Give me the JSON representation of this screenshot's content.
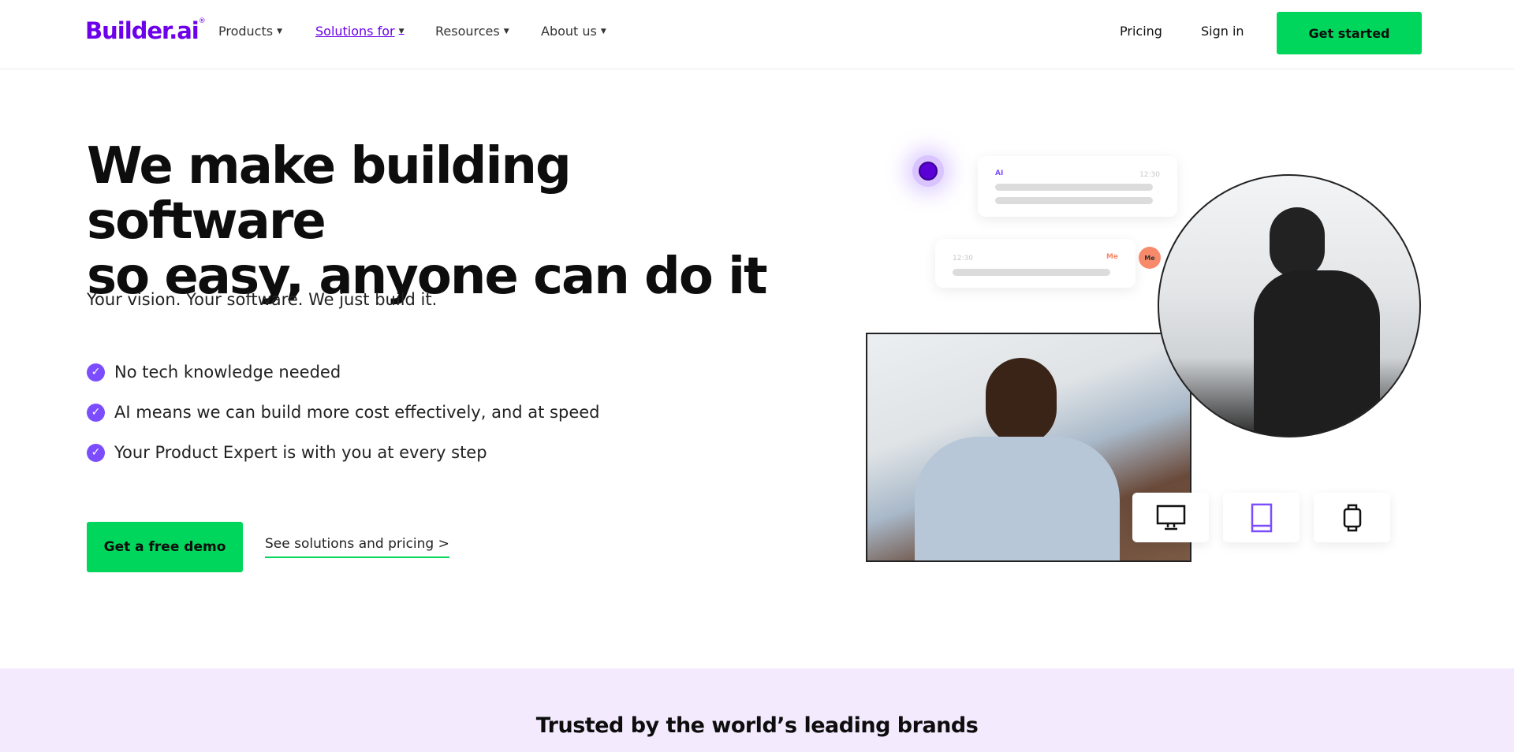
{
  "header": {
    "logo": "Builder.ai",
    "nav": [
      {
        "label": "Products"
      },
      {
        "label": "Solutions for",
        "active": true
      },
      {
        "label": "Resources"
      },
      {
        "label": "About us"
      }
    ],
    "pricing": "Pricing",
    "sign_in": "Sign in",
    "get_started": "Get started"
  },
  "hero": {
    "title_line1": "We make building software",
    "title_line2": "so easy, anyone can do it",
    "subtitle": "Your vision. Your software. We just build it.",
    "features": [
      "No tech knowledge needed",
      "AI means we can build more cost effectively, and at speed",
      "Your Product Expert is with you at every step"
    ],
    "demo_button": "Get a free demo",
    "solutions_link": "See solutions and pricing >"
  },
  "illustration": {
    "ai_label": "AI",
    "ai_time": "12:30",
    "me_label": "Me",
    "me_time": "12:30",
    "me_avatar": "Me",
    "devices": [
      "desktop-icon",
      "tablet-icon",
      "watch-icon"
    ],
    "colors": {
      "brand": "#6c00ea",
      "accent_green": "#00d65b",
      "me": "#f78a6b"
    }
  },
  "brands": {
    "title": "Trusted by the world’s leading brands"
  }
}
